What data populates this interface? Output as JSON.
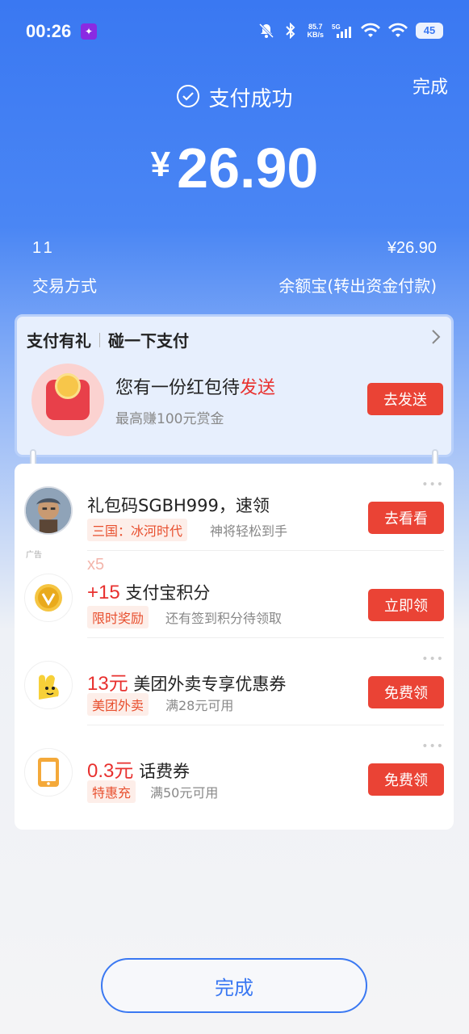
{
  "status_bar": {
    "time": "00:26",
    "net_speed_value": "85.7",
    "net_speed_unit": "KB/s",
    "network": "5G",
    "battery": "45"
  },
  "header": {
    "done_label": "完成",
    "success_text": "支付成功",
    "currency": "¥",
    "amount": "26.90"
  },
  "info": {
    "left_value": "11",
    "right_value": "¥26.90",
    "method_label": "交易方式",
    "method_value": "余额宝(转出资金付款)"
  },
  "gift": {
    "title": "支付有礼",
    "subtitle": "碰一下支付",
    "offer_prefix": "您有一份红包待",
    "offer_highlight": "发送",
    "offer_desc": "最高赚100元赏金",
    "button": "去发送"
  },
  "items": [
    {
      "title": "礼包码SGBH999，速领",
      "tag": "三国：冰河时代",
      "desc": "神将轻松到手",
      "button": "去看看",
      "ad": "广告"
    },
    {
      "badge": "x5",
      "num": "+15",
      "title": "支付宝积分",
      "tag": "限时奖励",
      "desc": "还有签到积分待领取",
      "button": "立即领"
    },
    {
      "num": "13元",
      "title": "美团外卖专享优惠券",
      "tag": "美团外卖",
      "desc": "满28元可用",
      "button": "免费领"
    },
    {
      "num": "0.3元",
      "title": "话费券",
      "tag": "特惠充",
      "desc": "满50元可用",
      "button": "免费领"
    }
  ],
  "footer": {
    "done_label": "完成"
  },
  "colors": {
    "brand_blue": "#3a78f2",
    "accent_red": "#ea4335"
  }
}
